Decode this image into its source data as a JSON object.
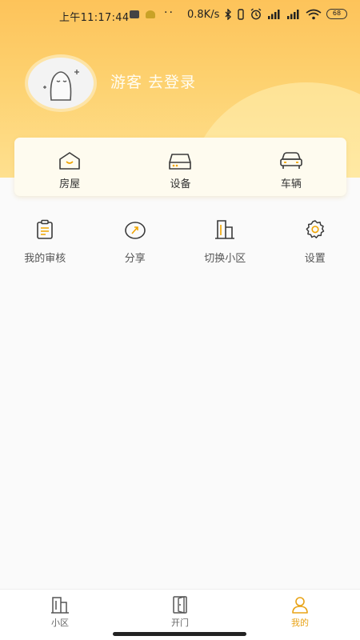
{
  "status_bar": {
    "time": "上午11:17:44",
    "dots": "··",
    "net_speed": "0.8K/s",
    "battery": "68"
  },
  "profile": {
    "login_text": "游客 去登录"
  },
  "card": {
    "items": [
      {
        "label": "房屋",
        "icon": "house-icon"
      },
      {
        "label": "设备",
        "icon": "device-icon"
      },
      {
        "label": "车辆",
        "icon": "car-icon"
      }
    ]
  },
  "menu": {
    "items": [
      {
        "label": "我的审核",
        "icon": "clipboard-icon"
      },
      {
        "label": "分享",
        "icon": "share-icon"
      },
      {
        "label": "切换小区",
        "icon": "building-icon"
      },
      {
        "label": "设置",
        "icon": "gear-icon"
      }
    ]
  },
  "tabbar": {
    "items": [
      {
        "label": "小区",
        "icon": "building-icon"
      },
      {
        "label": "开门",
        "icon": "door-icon"
      },
      {
        "label": "我的",
        "icon": "person-icon",
        "active": true
      }
    ]
  },
  "colors": {
    "accent": "#e8a317",
    "header_top": "#fdc35a",
    "header_bottom": "#fee08f",
    "icon_dark": "#3a3a3a",
    "icon_accent": "#f0a400"
  }
}
